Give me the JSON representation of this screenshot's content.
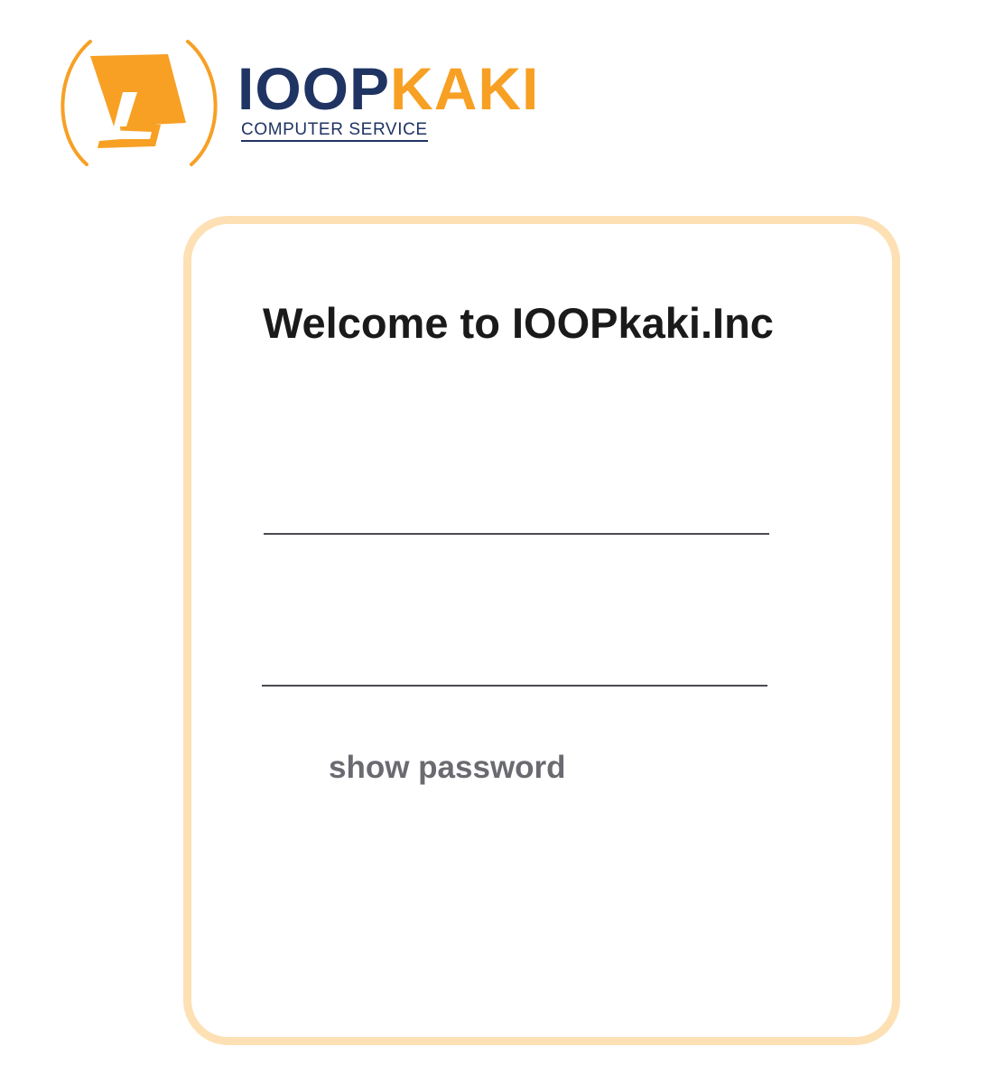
{
  "brand": {
    "logo_part_a": "IOOP",
    "logo_part_b": "KAKI",
    "tagline": "COMPUTER SERVICE",
    "colors": {
      "navy": "#1f3463",
      "orange": "#f7a024",
      "card_border": "#fde0b4"
    }
  },
  "login": {
    "title": "Welcome to IOOPkaki.Inc",
    "username": {
      "value": "",
      "placeholder": ""
    },
    "password": {
      "value": "",
      "placeholder": ""
    },
    "show_password_label": "show password",
    "show_password_checked": false
  }
}
